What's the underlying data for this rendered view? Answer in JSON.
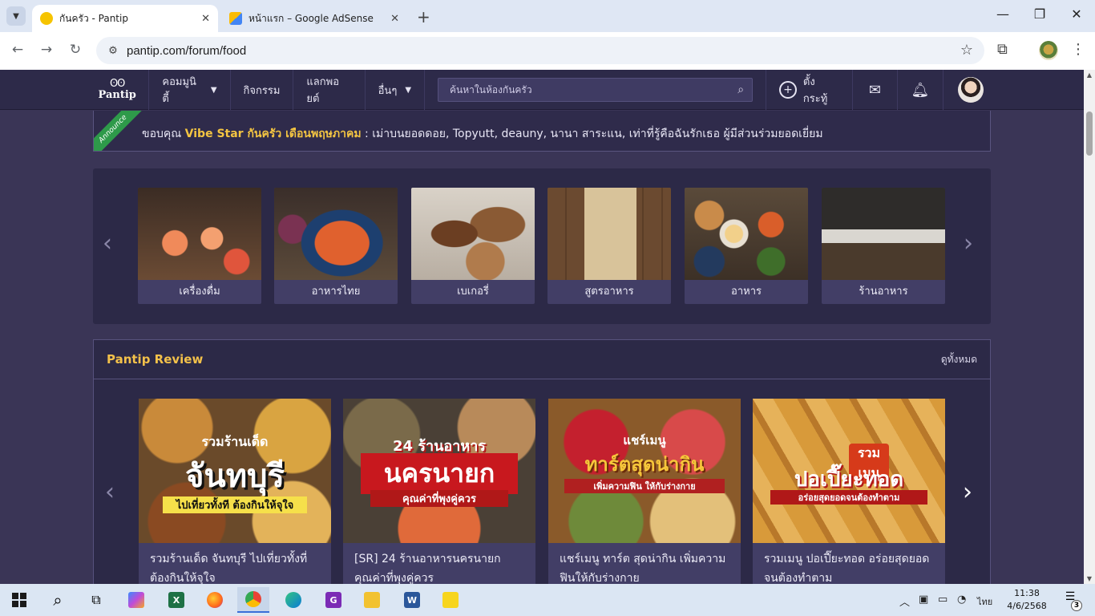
{
  "browser": {
    "tabs": [
      {
        "title": "กันครัว - Pantip",
        "active": true
      },
      {
        "title": "หน้าแรก – Google AdSense",
        "active": false
      }
    ],
    "url": "pantip.com/forum/food"
  },
  "header": {
    "logo": "Pantip",
    "nav": [
      {
        "label": "คอมมูนิตี้",
        "dropdown": true
      },
      {
        "label": "กิจกรรม",
        "dropdown": false
      },
      {
        "label": "แลกพอยต์",
        "dropdown": false
      },
      {
        "label": "อื่นๆ",
        "dropdown": true
      }
    ],
    "search_placeholder": "ค้นหาในห้องกันครัว",
    "create_label": "ตั้งกระทู้"
  },
  "announce": {
    "badge": "Announce",
    "prefix": "ขอบคุณ ",
    "highlight": "Vibe Star กันครัว เดือนพฤษภาคม",
    "rest": " : เม่าบนยอดดอย, Topyutt, deauny, นานา สาระแน, เท่าที่รู้คือฉันรักเธอ ผู้มีส่วนร่วมยอดเยี่ยม"
  },
  "categories": [
    {
      "label": "เครื่องดื่ม"
    },
    {
      "label": "อาหารไทย"
    },
    {
      "label": "เบเกอรี่"
    },
    {
      "label": "สูตรอาหาร"
    },
    {
      "label": "อาหาร"
    },
    {
      "label": "ร้านอาหาร"
    }
  ],
  "review": {
    "title": "Pantip Review",
    "see_all": "ดูทั้งหมด",
    "items": [
      {
        "title": "รวมร้านเด็ด จันทบุรี ไปเที่ยวทั้งที่ต้องกินให้จุใจ",
        "line1": "รวมร้านเด็ด",
        "line2": "จันทบุรี",
        "line3": "ไปเที่ยวทั้งที ต้องกินให้จุใจ"
      },
      {
        "title": "[SR] 24 ร้านอาหารนครนายก คุณค่าที่พุงคู่ควร",
        "line1": "24 ร้านอาหาร",
        "line2": "นครนายก",
        "line3": "คุณค่าที่พุงคู่ควร"
      },
      {
        "title": "แชร์เมนู ทาร์ต สุดน่ากิน เพิ่มความฟินให้กับร่างกาย",
        "line1": "แชร์เมนู",
        "line2": "ทาร์ตสุดน่ากิน",
        "line3": "เพิ่มความฟิน ให้กับร่างกาย"
      },
      {
        "title": "รวมเมนู ปอเปี๊ยะทอด อร่อยสุดยอดจนต้องทำตาม",
        "line1": "รวมเมนู",
        "line2": "ปอเปี๊ยะทอด",
        "line3": "อร่อยสุดยอดจนต้องทำตาม"
      }
    ]
  },
  "taskbar": {
    "language": "ไทย",
    "time": "11:38",
    "date": "4/6/2568",
    "notifications": "3"
  }
}
